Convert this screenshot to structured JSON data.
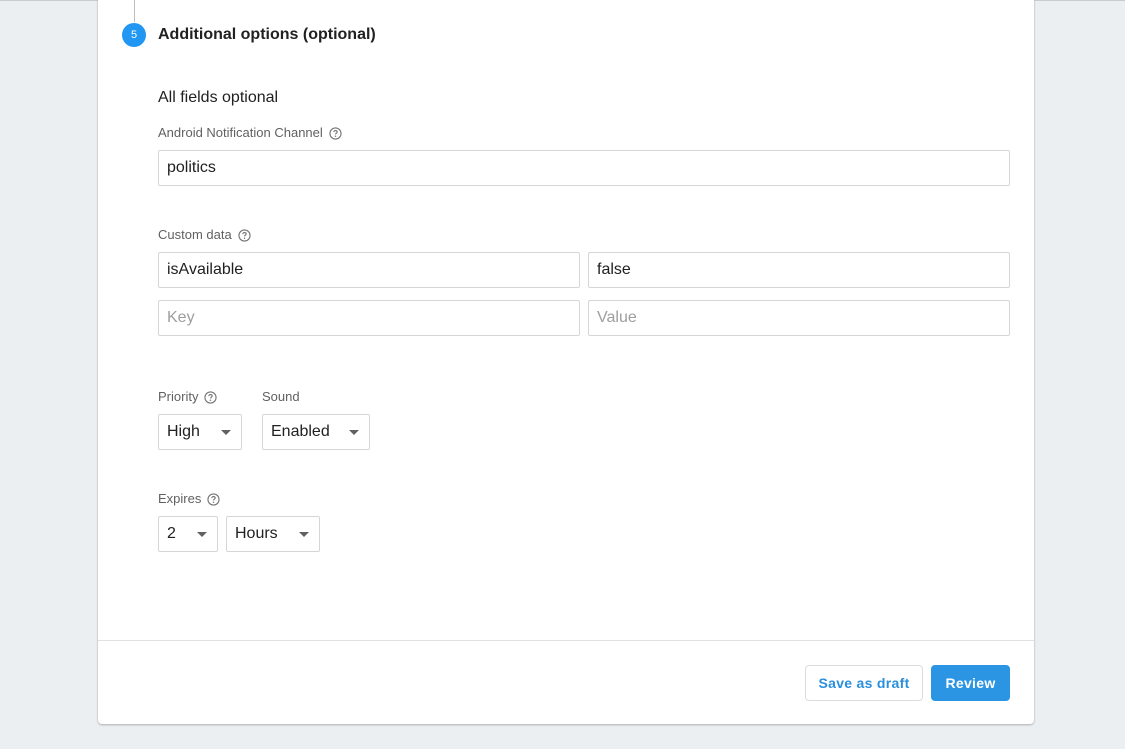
{
  "step": {
    "number": "5",
    "title": "Additional options (optional)"
  },
  "subhead": "All fields optional",
  "android_channel": {
    "label": "Android Notification Channel",
    "value": "politics"
  },
  "custom_data": {
    "label": "Custom data",
    "rows": [
      {
        "key": "isAvailable",
        "value": "false"
      }
    ],
    "key_placeholder": "Key",
    "value_placeholder": "Value"
  },
  "priority": {
    "label": "Priority",
    "selected": "High"
  },
  "sound": {
    "label": "Sound",
    "selected": "Enabled"
  },
  "expires": {
    "label": "Expires",
    "amount": "2",
    "unit": "Hours"
  },
  "actions": {
    "save_draft_label": "Save as draft",
    "review_label": "Review"
  },
  "colors": {
    "accent": "#2196f3",
    "button_primary": "#2b94e3",
    "background": "#eceff1"
  },
  "icons": {
    "help": "help-circle-icon",
    "dropdown": "caret-down-icon"
  }
}
